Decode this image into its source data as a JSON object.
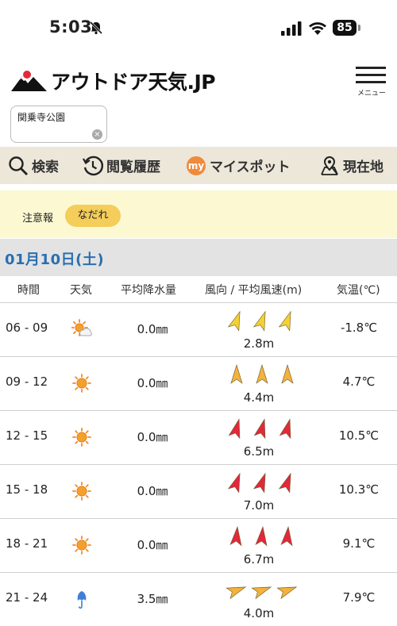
{
  "status_bar": {
    "time": "5:03",
    "battery": "85"
  },
  "header": {
    "logo_text": "アウトドア天気.JP",
    "menu_label": "メニュー"
  },
  "location": {
    "value": "関乗寺公園"
  },
  "nav": {
    "items": [
      {
        "label": "検索",
        "icon": "search-icon"
      },
      {
        "label": "閲覧履歴",
        "icon": "history-icon"
      },
      {
        "label": "マイスポット",
        "icon": "my-badge-icon",
        "badge": "my"
      },
      {
        "label": "現在地",
        "icon": "map-pin-icon"
      }
    ]
  },
  "alert": {
    "label": "注意報",
    "pill": "なだれ"
  },
  "date": "01月10日(土)",
  "table": {
    "headers": {
      "time": "時間",
      "weather": "天気",
      "precip": "平均降水量",
      "wind": "風向 / 平均風速(m)",
      "temp": "気温(℃)"
    },
    "rows": [
      {
        "time": "06 - 09",
        "weather": "sun-cloud-icon",
        "precip": "0.0㎜",
        "wind_speed": "2.8m",
        "temp": "-1.8℃",
        "wind_color": "#f3d034",
        "wind_angle": 20
      },
      {
        "time": "09 - 12",
        "weather": "sun-icon",
        "precip": "0.0㎜",
        "wind_speed": "4.4m",
        "temp": "4.7℃",
        "wind_color": "#f3b23c",
        "wind_angle": 0
      },
      {
        "time": "12 - 15",
        "weather": "sun-icon",
        "precip": "0.0㎜",
        "wind_speed": "6.5m",
        "temp": "10.5℃",
        "wind_color": "#e2283a",
        "wind_angle": 15
      },
      {
        "time": "15 - 18",
        "weather": "sun-icon",
        "precip": "0.0㎜",
        "wind_speed": "7.0m",
        "temp": "10.3℃",
        "wind_color": "#e2283a",
        "wind_angle": 20
      },
      {
        "time": "18 - 21",
        "weather": "sun-icon",
        "precip": "0.0㎜",
        "wind_speed": "6.7m",
        "temp": "9.1℃",
        "wind_color": "#e2283a",
        "wind_angle": 5
      },
      {
        "time": "21 - 24",
        "weather": "umbrella-icon",
        "precip": "3.5㎜",
        "wind_speed": "4.0m",
        "temp": "7.9℃",
        "wind_color": "#f3b23c",
        "wind_angle": 70
      }
    ]
  }
}
